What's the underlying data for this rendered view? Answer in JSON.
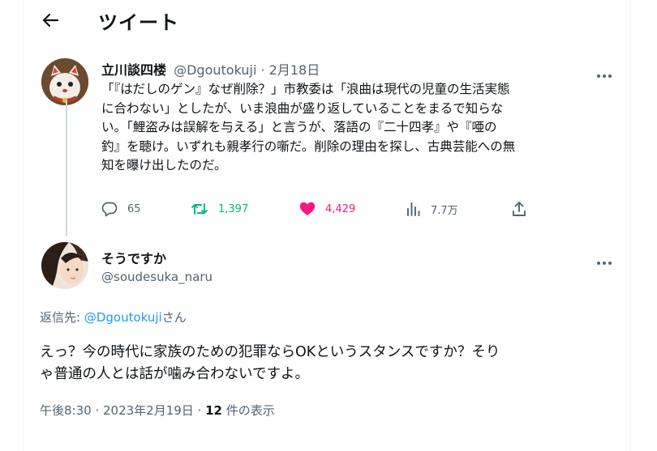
{
  "header": {
    "title": "ツイート"
  },
  "original": {
    "display_name": "立川談四楼",
    "handle": "@Dgoutokuji",
    "separator": "·",
    "date": "2月18日",
    "lines": [
      "「『はだしのゲン』なぜ削除？」市教委は「浪曲は現代の児童の生活実態",
      "に合わない」としたが、いま浪曲が盛り返していることをまるで知らな",
      "い。「鯉盗みは誤解を与える」と言うが、落語の『二十四孝』や『唖の",
      "釣』を聴け。いずれも親孝行の噺だ。削除の理由を探し、古典芸能への無",
      "知を曝け出したのだ。"
    ],
    "stats": {
      "replies": "65",
      "retweets": "1,397",
      "likes": "4,429",
      "views": "7.7万"
    },
    "colors": {
      "retweet": "#00ba7c",
      "like": "#f91880"
    }
  },
  "reply": {
    "display_name": "そうですか",
    "handle": "@soudesuka_naru",
    "reply_to_prefix": "返信先: ",
    "reply_to_handle": "@Dgoutokuji",
    "reply_to_suffix": "さん",
    "lines": [
      "えっ？今の時代に家族のための犯罪ならOKというスタンスですか？そり",
      "ゃ普通の人とは話が噛み合わないですよ。"
    ],
    "time": "午後8:30",
    "dot": " · ",
    "date": "2023年2月19日",
    "dot2": " · ",
    "views_count": "12",
    "views_label": " 件の表示"
  }
}
